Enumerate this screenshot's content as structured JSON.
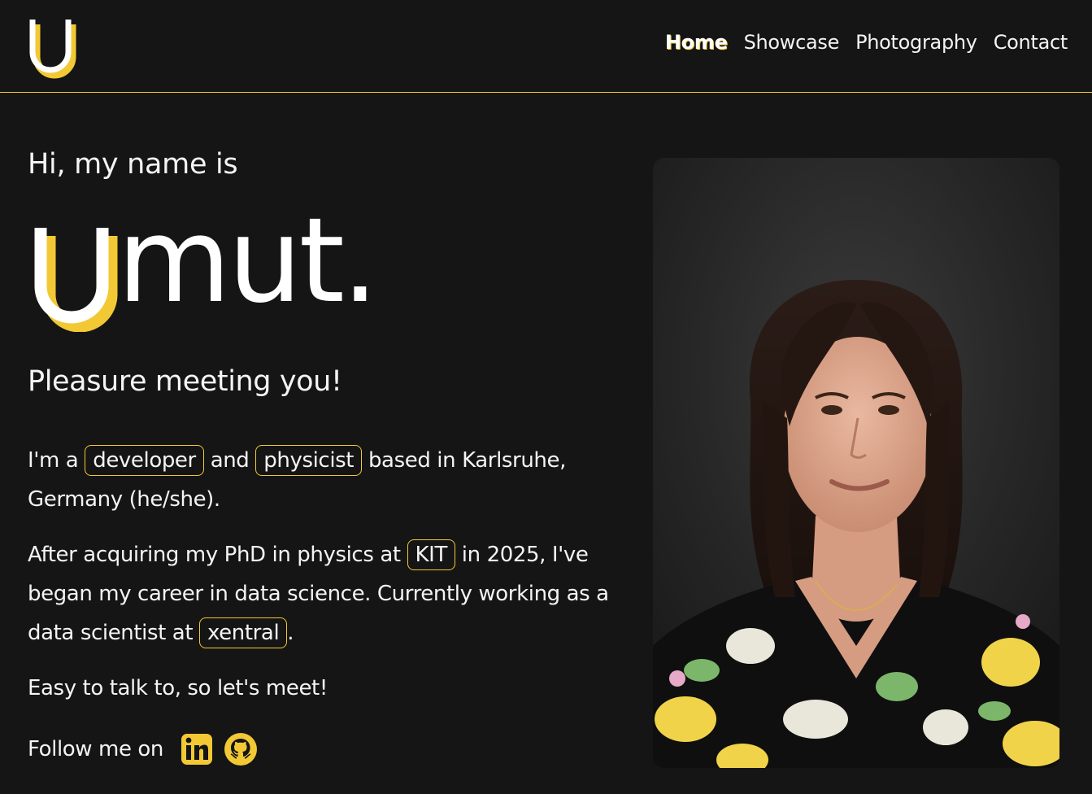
{
  "nav": {
    "items": [
      "Home",
      "Showcase",
      "Photography",
      "Contact"
    ],
    "active": "Home"
  },
  "hero": {
    "greeting": "Hi, my name is",
    "name_rest": "mut.",
    "tagline": "Pleasure meeting you!",
    "p1": {
      "t1": "I'm a ",
      "chip1": "developer",
      "t2": " and ",
      "chip2": "physicist",
      "t3": " based in Karlsruhe, Germany (he/she)."
    },
    "p2": {
      "t1": "After acquiring my PhD in physics at ",
      "chip1": "KIT",
      "t2": " in 2025, I've began my career in data science. Currently working as a data scientist at ",
      "chip2": "xentral",
      "t3": "."
    },
    "p3": "Easy to talk to, so let's meet!",
    "follow_label": "Follow me on",
    "social": [
      "linkedin-icon",
      "github-icon"
    ]
  },
  "colors": {
    "background": "#151515",
    "accent": "#f2c934",
    "text": "#f4f4f4"
  }
}
